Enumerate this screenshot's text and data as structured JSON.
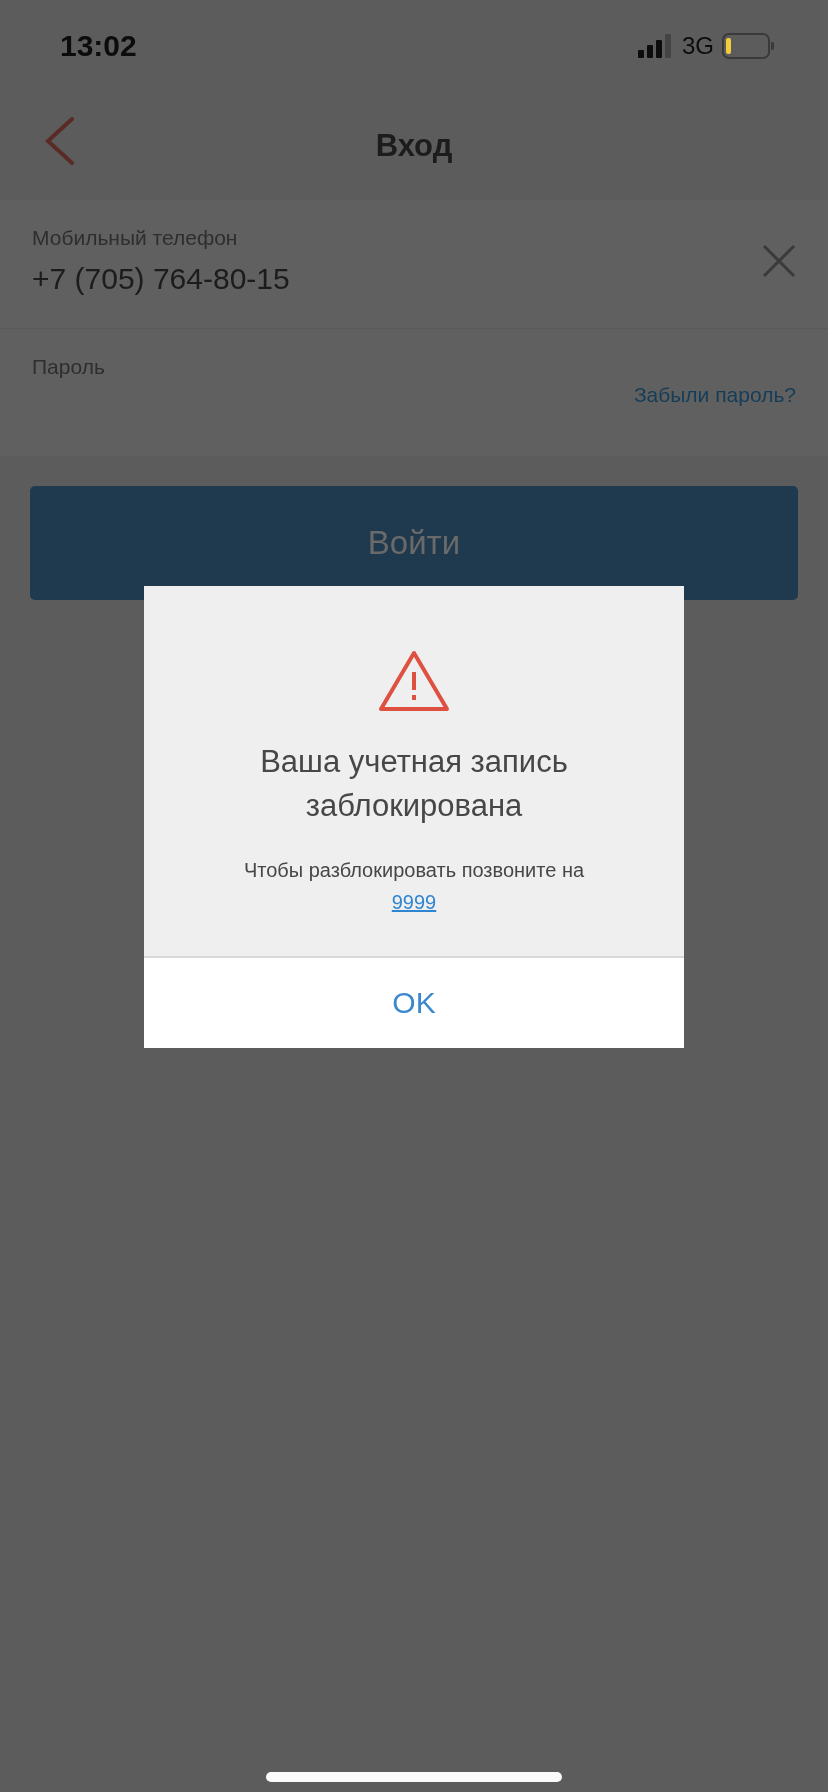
{
  "status_bar": {
    "time": "13:02",
    "network": "3G"
  },
  "nav": {
    "title": "Вход"
  },
  "form": {
    "phone": {
      "label": "Мобильный телефон",
      "value": "+7 (705) 764-80-15"
    },
    "password": {
      "label": "Пароль",
      "forgot_link": "Забыли пароль?"
    }
  },
  "login_button": "Войти",
  "dialog": {
    "title": "Ваша учетная запись заблокирована",
    "message": "Чтобы разблокировать позвоните на",
    "phone_link": "9999",
    "button": "OK"
  }
}
